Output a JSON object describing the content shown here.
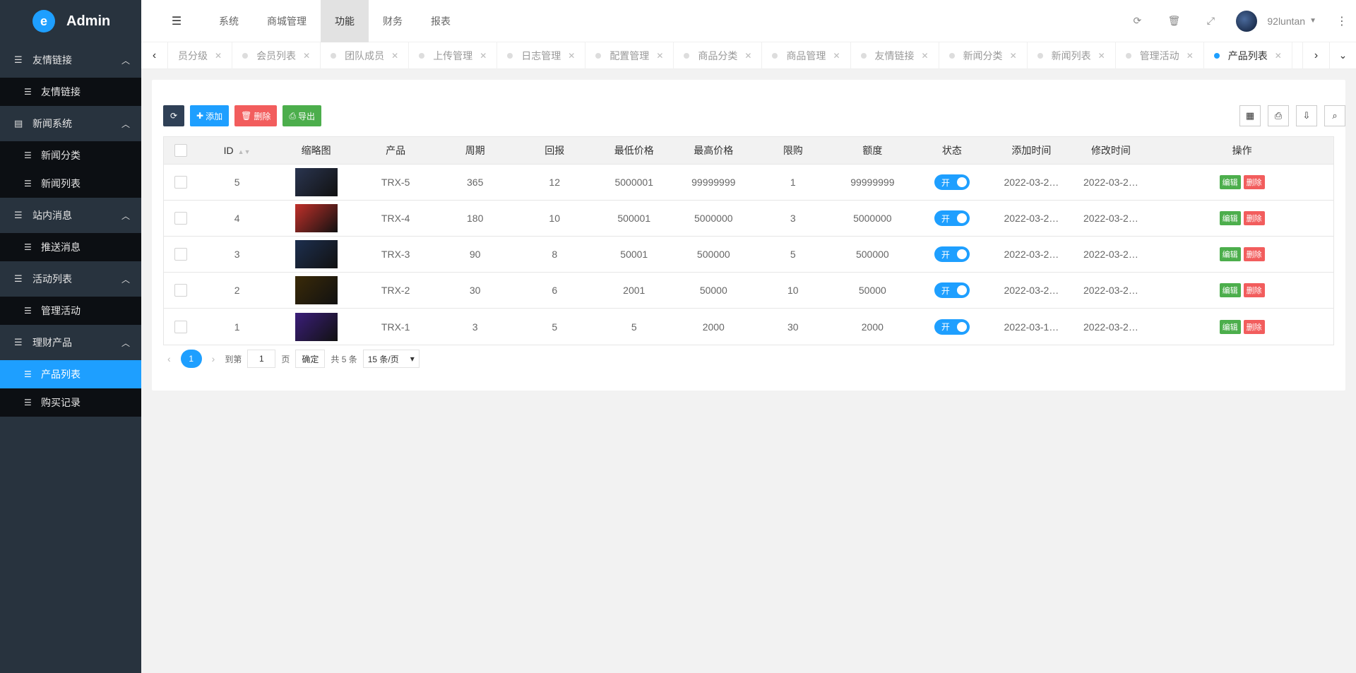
{
  "app": {
    "title": "Admin"
  },
  "sidebar": {
    "groups": [
      {
        "label": "友情链接",
        "items": [
          {
            "label": "友情链接",
            "active": false
          }
        ]
      },
      {
        "label": "新闻系统",
        "items": [
          {
            "label": "新闻分类",
            "active": false
          },
          {
            "label": "新闻列表",
            "active": false
          }
        ]
      },
      {
        "label": "站内消息",
        "items": [
          {
            "label": "推送消息",
            "active": false
          }
        ]
      },
      {
        "label": "活动列表",
        "items": [
          {
            "label": "管理活动",
            "active": false
          }
        ]
      },
      {
        "label": "理财产品",
        "items": [
          {
            "label": "产品列表",
            "active": true
          },
          {
            "label": "购买记录",
            "active": false
          }
        ]
      }
    ]
  },
  "header": {
    "nav": [
      {
        "label": "系统",
        "active": false
      },
      {
        "label": "商城管理",
        "active": false
      },
      {
        "label": "功能",
        "active": true
      },
      {
        "label": "财务",
        "active": false
      },
      {
        "label": "报表",
        "active": false
      }
    ],
    "username": "92luntan"
  },
  "tabs": [
    {
      "label": "员分级",
      "active": false,
      "dot": false
    },
    {
      "label": "会员列表",
      "active": false,
      "dot": true
    },
    {
      "label": "团队成员",
      "active": false,
      "dot": true
    },
    {
      "label": "上传管理",
      "active": false,
      "dot": true
    },
    {
      "label": "日志管理",
      "active": false,
      "dot": true
    },
    {
      "label": "配置管理",
      "active": false,
      "dot": true
    },
    {
      "label": "商品分类",
      "active": false,
      "dot": true
    },
    {
      "label": "商品管理",
      "active": false,
      "dot": true
    },
    {
      "label": "友情链接",
      "active": false,
      "dot": true
    },
    {
      "label": "新闻分类",
      "active": false,
      "dot": true
    },
    {
      "label": "新闻列表",
      "active": false,
      "dot": true
    },
    {
      "label": "管理活动",
      "active": false,
      "dot": true
    },
    {
      "label": "产品列表",
      "active": true,
      "dot": true
    }
  ],
  "toolbar": {
    "add_label": "添加",
    "delete_label": "删除",
    "export_label": "导出"
  },
  "table": {
    "headers": {
      "id": "ID",
      "thumb": "缩略图",
      "product": "产品",
      "cycle": "周期",
      "return": "回报",
      "min_price": "最低价格",
      "max_price": "最高价格",
      "limit": "限购",
      "amount": "额度",
      "status": "状态",
      "added": "添加时间",
      "modified": "修改时间",
      "actions": "操作"
    },
    "rows": [
      {
        "id": "5",
        "product": "TRX-5",
        "cycle": "365",
        "return": "12",
        "min_price": "5000001",
        "max_price": "99999999",
        "limit": "1",
        "amount": "99999999",
        "status": "开",
        "added": "2022-03-2…",
        "modified": "2022-03-2…",
        "thumb_color": "#2a3550"
      },
      {
        "id": "4",
        "product": "TRX-4",
        "cycle": "180",
        "return": "10",
        "min_price": "500001",
        "max_price": "5000000",
        "limit": "3",
        "amount": "5000000",
        "status": "开",
        "added": "2022-03-2…",
        "modified": "2022-03-2…",
        "thumb_color": "#c0302a"
      },
      {
        "id": "3",
        "product": "TRX-3",
        "cycle": "90",
        "return": "8",
        "min_price": "50001",
        "max_price": "500000",
        "limit": "5",
        "amount": "500000",
        "status": "开",
        "added": "2022-03-2…",
        "modified": "2022-03-2…",
        "thumb_color": "#1d2f4f"
      },
      {
        "id": "2",
        "product": "TRX-2",
        "cycle": "30",
        "return": "6",
        "min_price": "2001",
        "max_price": "50000",
        "limit": "10",
        "amount": "50000",
        "status": "开",
        "added": "2022-03-2…",
        "modified": "2022-03-2…",
        "thumb_color": "#3a2a08"
      },
      {
        "id": "1",
        "product": "TRX-1",
        "cycle": "3",
        "return": "5",
        "min_price": "5",
        "max_price": "2000",
        "limit": "30",
        "amount": "2000",
        "status": "开",
        "added": "2022-03-1…",
        "modified": "2022-03-2…",
        "thumb_color": "#3b1e7a"
      }
    ],
    "edit_label": "编辑",
    "delete_label": "删除"
  },
  "pager": {
    "current": "1",
    "goto_label": "到第",
    "page_value": "1",
    "page_label": "页",
    "confirm_label": "确定",
    "total_label": "共 5 条",
    "page_size": "15 条/页"
  },
  "colors": {
    "accent": "#1e9fff",
    "sidebar": "#28333e",
    "danger": "#f25d5d",
    "success": "#4cae4c"
  }
}
